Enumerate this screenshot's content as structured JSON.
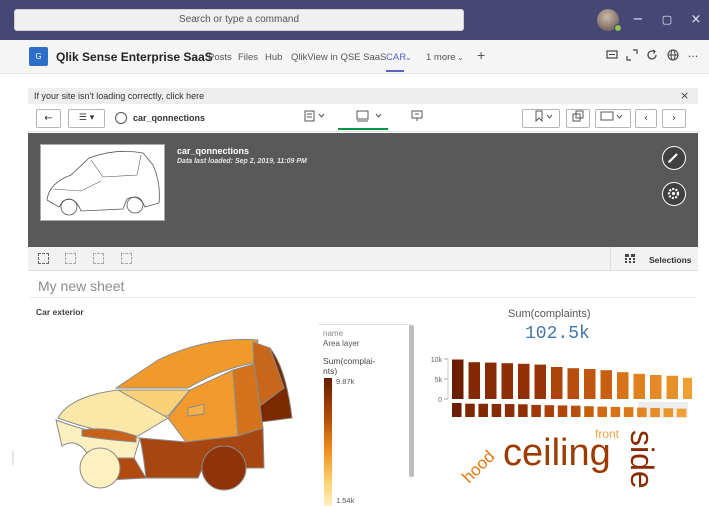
{
  "teams": {
    "search_placeholder": "Search or type a command",
    "minimize": "−",
    "maximize": "▢",
    "close": "×"
  },
  "app_bar": {
    "logo_text": "G",
    "title": "Qlik Sense Enterprise SaaS",
    "tabs": [
      "Posts",
      "Files",
      "Hub",
      "QlikView in QSE SaaS",
      "CAR",
      "1 more"
    ],
    "active_tab": "CAR",
    "add_tab": "+"
  },
  "notice": {
    "text": "If your site isn't loading correctly, click here",
    "close": "×"
  },
  "toolbar": {
    "back": "←",
    "menu": "☰ ▾",
    "app_name": "car_qonnections",
    "prev": "‹",
    "next": "›"
  },
  "header": {
    "sheet_name": "car_qonnections",
    "loaded": "Data last loaded: Sep 2, 2019, 11:09 PM"
  },
  "selections": {
    "label": "Selections"
  },
  "sheet": {
    "title": "My new sheet",
    "car_title": "Car exterior"
  },
  "legend": {
    "name_label": "name",
    "layer": "Area layer",
    "measure_line1": "Sum(complai-",
    "measure_line2": "nts)",
    "max": "9.87k",
    "min": "1.54k"
  },
  "kpi": {
    "title": "Sum(complaints)",
    "value": "102.5k"
  },
  "colors": {
    "teams_purple": "#464775",
    "qlik_green": "#009845",
    "header_gray": "#595959",
    "kpi_blue": "#4477aa",
    "heat_dark": "#6a1b00",
    "heat_light": "#fff1bf"
  },
  "chart_data": {
    "type": "bar",
    "title": "",
    "xlabel": "",
    "ylabel": "",
    "y_ticks": [
      "10k",
      "5k",
      "0"
    ],
    "ylim": [
      0,
      10000
    ],
    "values": [
      9870,
      9200,
      9100,
      8950,
      8800,
      8600,
      8000,
      7700,
      7500,
      7200,
      6700,
      6300,
      6000,
      5800,
      5300
    ],
    "mini_values": [
      9870,
      9200,
      9100,
      8950,
      8800,
      8600,
      8000,
      7700,
      7500,
      7200,
      6700,
      6300,
      6000,
      5800,
      5300,
      5000,
      4700,
      4300
    ],
    "legend_position": "none"
  },
  "word_cloud": {
    "words": [
      {
        "text": "ceiling",
        "color": "#9c3a00"
      },
      {
        "text": "side",
        "color": "#8a2a00"
      },
      {
        "text": "hood",
        "color": "#e07a10"
      },
      {
        "text": "front",
        "color": "#f0a040"
      }
    ]
  }
}
